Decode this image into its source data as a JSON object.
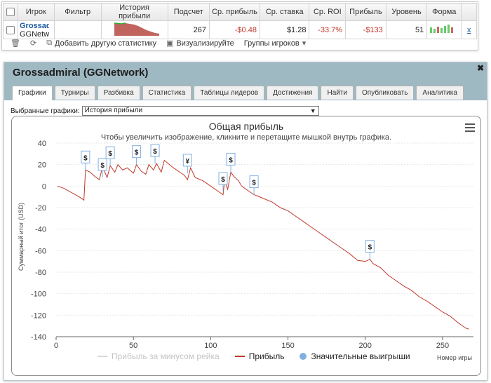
{
  "grid": {
    "headers": [
      "Игрок",
      "Фильтр",
      "История прибыли",
      "Подсчет",
      "Ср. прибыль",
      "Ср. ставка",
      "Ср. ROI",
      "Прибыль",
      "Уровень",
      "Форма"
    ],
    "row": {
      "player": "Grossadmiral",
      "network": "GGNetwork",
      "count": "267",
      "avg_profit": "-$0.48",
      "avg_stake": "$1.28",
      "avg_roi": "-33.7%",
      "profit": "-$133",
      "level": "51",
      "remove": "x"
    },
    "tools": {
      "add_stat": "Добавить другую статистику",
      "visualize": "Визуализируйте",
      "groups": "Группы игроков"
    }
  },
  "panel": {
    "title": "Grossadmiral (GGNetwork)",
    "tabs": [
      "Графики",
      "Турниры",
      "Разбивка",
      "Статистика",
      "Таблицы лидеров",
      "Достижения",
      "Найти",
      "Опубликовать",
      "Аналитика"
    ],
    "active_tab": "Графики",
    "select_label": "Выбранные графики:",
    "select_value": "История прибыли"
  },
  "chart_data": {
    "type": "line",
    "title": "Общая прибыль",
    "subtitle": "Чтобы увеличить изображение, кликните и перетащите мышкой внутрь графика.",
    "xlabel": "Номер игры",
    "ylabel": "Суммарный итог (USD)",
    "xlim": [
      0,
      270
    ],
    "ylim": [
      -140,
      40
    ],
    "xticks": [
      0,
      50,
      100,
      150,
      200,
      250
    ],
    "yticks": [
      40,
      20,
      0,
      -20,
      -40,
      -60,
      -80,
      -100,
      -120,
      -140
    ],
    "series": [
      {
        "name": "Прибыль",
        "color": "#c0392b",
        "x": [
          1,
          5,
          10,
          15,
          18,
          19,
          22,
          25,
          28,
          30,
          33,
          35,
          38,
          40,
          43,
          46,
          50,
          52,
          55,
          58,
          60,
          63,
          65,
          68,
          70,
          75,
          80,
          83,
          85,
          87,
          90,
          95,
          100,
          105,
          108,
          109,
          111,
          113,
          115,
          118,
          120,
          125,
          128,
          130,
          135,
          140,
          145,
          150,
          155,
          160,
          165,
          170,
          175,
          180,
          185,
          190,
          195,
          200,
          203,
          205,
          210,
          215,
          220,
          225,
          230,
          235,
          240,
          245,
          250,
          255,
          260,
          265,
          267
        ],
        "values": [
          0,
          -2,
          -6,
          -10,
          -13,
          15,
          13,
          9,
          6,
          18,
          8,
          19,
          13,
          20,
          15,
          17,
          12,
          20,
          14,
          11,
          20,
          15,
          21,
          13,
          24,
          18,
          13,
          10,
          6,
          17,
          8,
          5,
          0,
          -5,
          -8,
          5,
          -3,
          13,
          9,
          5,
          0,
          -5,
          -8,
          -9,
          -12,
          -15,
          -20,
          -23,
          -28,
          -33,
          -38,
          -43,
          -48,
          -53,
          -58,
          -63,
          -69,
          -70,
          -68,
          -72,
          -76,
          -83,
          -88,
          -93,
          -97,
          -103,
          -107,
          -112,
          -117,
          -121,
          -127,
          -132,
          -133
        ]
      }
    ],
    "faded_series_name": "Прибыль за минусом рейка",
    "markers_series_name": "Значительные выигрыши",
    "markers": [
      {
        "x": 19,
        "y": 15,
        "label": "$"
      },
      {
        "x": 30,
        "y": 8,
        "label": "$"
      },
      {
        "x": 35,
        "y": 19,
        "label": "$"
      },
      {
        "x": 52,
        "y": 20,
        "label": "$"
      },
      {
        "x": 64,
        "y": 21,
        "label": "$"
      },
      {
        "x": 85,
        "y": 12,
        "label": "¥"
      },
      {
        "x": 108,
        "y": -5,
        "label": "$"
      },
      {
        "x": 113,
        "y": 13,
        "label": "$"
      },
      {
        "x": 128,
        "y": -8,
        "label": "$"
      },
      {
        "x": 203,
        "y": -68,
        "label": "$"
      }
    ]
  }
}
